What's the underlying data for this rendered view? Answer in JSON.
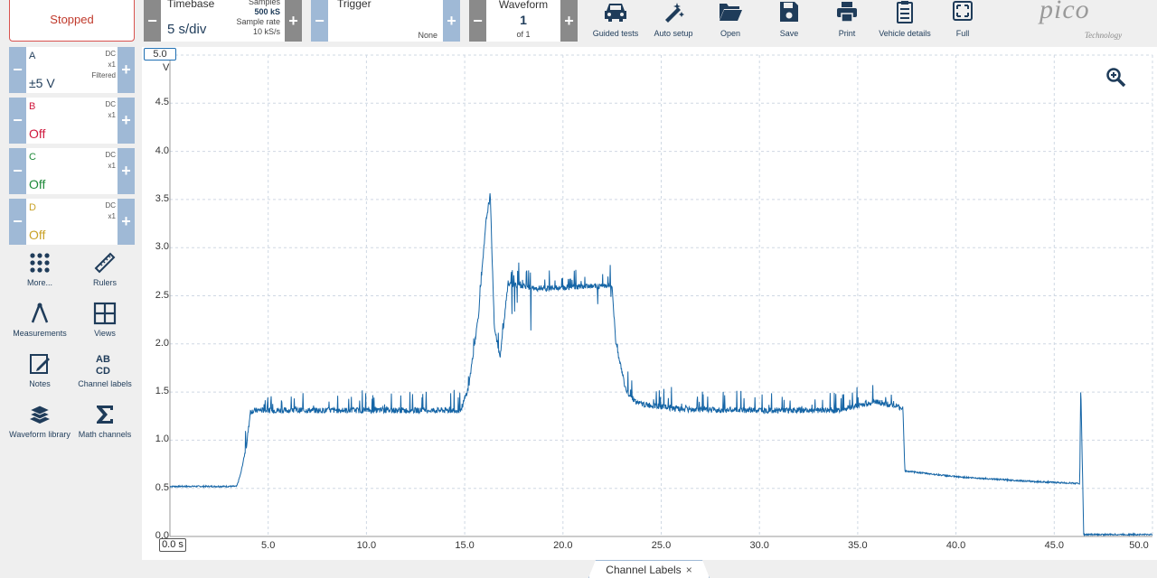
{
  "toolbar": {
    "run_status": "Stopped",
    "timebase": {
      "label": "Timebase",
      "value": "5 s/div",
      "samples_label": "Samples",
      "samples_value": "500 kS",
      "rate_label": "Sample rate",
      "rate_value": "10 kS/s"
    },
    "trigger": {
      "label": "Trigger",
      "value": "None"
    },
    "waveform": {
      "label": "Waveform",
      "number": "1",
      "of": "of 1"
    },
    "tools": [
      "Guided tests",
      "Auto setup",
      "Open",
      "Save",
      "Print",
      "Vehicle details",
      "Full"
    ],
    "logo": {
      "brand": "pico",
      "sub": "Technology"
    }
  },
  "channels": [
    {
      "name": "A",
      "coupling": "DC",
      "probe": "x1",
      "filter": "Filtered",
      "range": "±5 V",
      "color": "#1f6fb2"
    },
    {
      "name": "B",
      "coupling": "DC",
      "probe": "x1",
      "filter": "",
      "range": "Off",
      "color": "#d0193e"
    },
    {
      "name": "C",
      "coupling": "DC",
      "probe": "x1",
      "filter": "",
      "range": "Off",
      "color": "#1f8a3a"
    },
    {
      "name": "D",
      "coupling": "DC",
      "probe": "x1",
      "filter": "",
      "range": "Off",
      "color": "#c9a227"
    }
  ],
  "left_tools": [
    {
      "label": "More...",
      "icon": "grid-dots-icon"
    },
    {
      "label": "Rulers",
      "icon": "ruler-icon"
    },
    {
      "label": "Measurements",
      "icon": "compass-icon"
    },
    {
      "label": "Views",
      "icon": "views-grid-icon"
    },
    {
      "label": "Notes",
      "icon": "notes-icon"
    },
    {
      "label": "Channel labels",
      "icon": "abcd-icon"
    },
    {
      "label": "Waveform library",
      "icon": "library-icon"
    },
    {
      "label": "Math channels",
      "icon": "sigma-icon"
    }
  ],
  "scope": {
    "y_top_label": "5.0",
    "y_unit": "V",
    "y_ticks": [
      "4.5",
      "4.0",
      "3.5",
      "3.0",
      "2.5",
      "2.0",
      "1.5",
      "1.0",
      "0.5",
      "0.0"
    ],
    "x_start_label": "0.0 s",
    "x_ticks": [
      "5.0",
      "10.0",
      "15.0",
      "20.0",
      "25.0",
      "30.0",
      "35.0",
      "40.0",
      "45.0",
      "50.0"
    ],
    "trace_color": "#1565a6"
  },
  "chart_data": {
    "type": "line",
    "xlim": [
      0,
      50
    ],
    "ylim": [
      0,
      5
    ],
    "grid": true,
    "series": [
      {
        "x": [
          0,
          3.4,
          3.6,
          3.9,
          4.1,
          4.5,
          10,
          14.8,
          15.2,
          15.7,
          16.1,
          16.3,
          16.5,
          16.8,
          17.2,
          19,
          21,
          22.5,
          22.7,
          23.2,
          23.8,
          26,
          30,
          34,
          35,
          36,
          37.3,
          37.4,
          40,
          44,
          46.3,
          46.35,
          46.5,
          50
        ],
        "y": [
          0.52,
          0.52,
          0.65,
          0.95,
          1.3,
          1.31,
          1.31,
          1.31,
          1.55,
          2.3,
          3.3,
          3.55,
          2.2,
          1.85,
          2.62,
          2.57,
          2.6,
          2.6,
          2.0,
          1.52,
          1.38,
          1.32,
          1.31,
          1.31,
          1.36,
          1.4,
          1.33,
          0.68,
          0.62,
          0.57,
          0.55,
          1.58,
          0.02,
          0.02
        ]
      }
    ]
  },
  "bottom": {
    "tab_label": "Channel Labels",
    "close": "×"
  }
}
